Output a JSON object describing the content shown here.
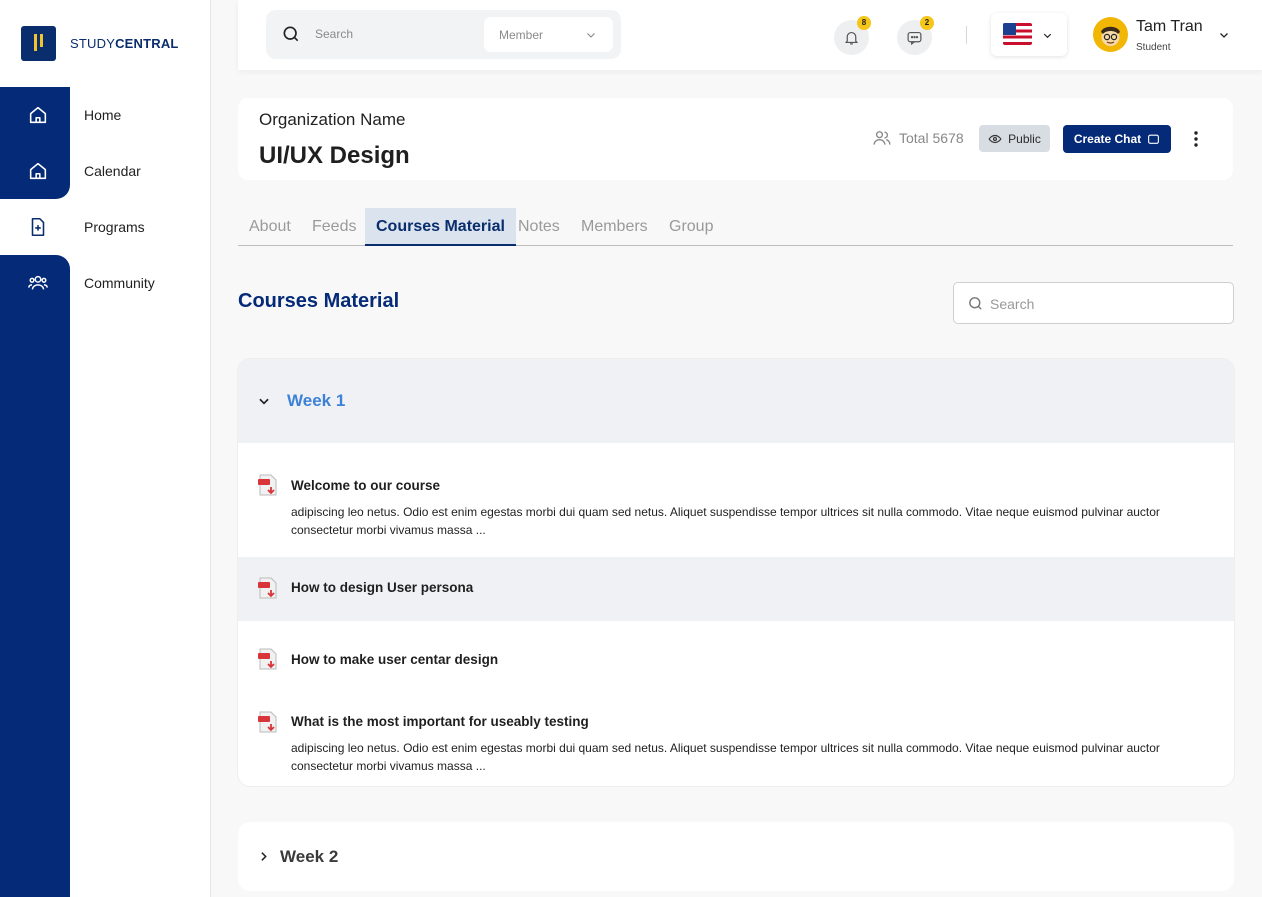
{
  "brand": {
    "prefix": "STUDY",
    "suffix": "CENTRAL"
  },
  "sidebar": {
    "items": [
      {
        "label": "Home",
        "icon": "home-icon"
      },
      {
        "label": "Calendar",
        "icon": "home-icon"
      },
      {
        "label": "Programs",
        "icon": "file-plus-icon"
      },
      {
        "label": "Community",
        "icon": "users-icon"
      }
    ]
  },
  "topbar": {
    "search_placeholder": "Search",
    "filter_value": "Member",
    "notifications_count": "8",
    "messages_count": "2",
    "language_flag": "us-flag",
    "user_name": "Tam Tran",
    "user_role": "Student"
  },
  "header": {
    "org_label": "Organization Name",
    "title": "UI/UX Design",
    "total": "Total 5678",
    "visibility": "Public",
    "create_chat": "Create Chat"
  },
  "tabs": [
    {
      "label": "About",
      "active": false
    },
    {
      "label": "Feeds",
      "active": false
    },
    {
      "label": "Courses Material",
      "active": true
    },
    {
      "label": "Notes",
      "active": false
    },
    {
      "label": "Members",
      "active": false
    },
    {
      "label": "Group",
      "active": false
    }
  ],
  "materials": {
    "title": "Courses Material",
    "search_placeholder": "Search",
    "weeks": [
      {
        "title": "Week 1",
        "expanded": true,
        "items": [
          {
            "title": "Welcome to our course",
            "description": "adipiscing leo netus. Odio est enim egestas morbi dui quam sed netus. Aliquet suspendisse tempor ultrices sit nulla commodo. Vitae neque euismod pulvinar auctor consectetur morbi vivamus massa ..."
          },
          {
            "title": "How to design User persona",
            "description": ""
          },
          {
            "title": "How to make user centar design",
            "description": ""
          },
          {
            "title": "What is the most important for useably testing",
            "description": "adipiscing leo netus. Odio est enim egestas morbi dui quam sed netus. Aliquet suspendisse tempor ultrices sit nulla commodo. Vitae neque euismod pulvinar auctor consectetur morbi vivamus massa ..."
          }
        ]
      },
      {
        "title": "Week 2",
        "expanded": false,
        "items": []
      }
    ]
  },
  "colors": {
    "primary": "#052a78",
    "accent": "#3d82d6",
    "badge": "#f5c518"
  }
}
